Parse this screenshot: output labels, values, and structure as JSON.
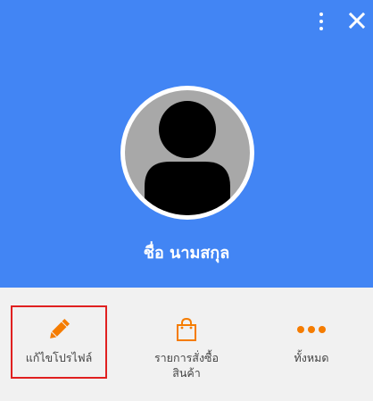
{
  "header": {
    "user_name": "ชื่อ นามสกุล",
    "background_color": "#4285f4",
    "menu_icon": "more-vertical-icon",
    "close_icon": "close-icon"
  },
  "avatar": {
    "icon": "user-silhouette-icon"
  },
  "actions": [
    {
      "label": "แก้ไขโปรไฟล์",
      "icon": "pencil-icon",
      "selected": true
    },
    {
      "label": "รายการสั่งซื้อสินค้า",
      "icon": "shopping-bag-icon",
      "selected": false
    },
    {
      "label": "ทั้งหมด",
      "icon": "more-horizontal-icon",
      "selected": false
    }
  ],
  "colors": {
    "accent": "#f57c00",
    "selection_outline": "#e02020"
  }
}
